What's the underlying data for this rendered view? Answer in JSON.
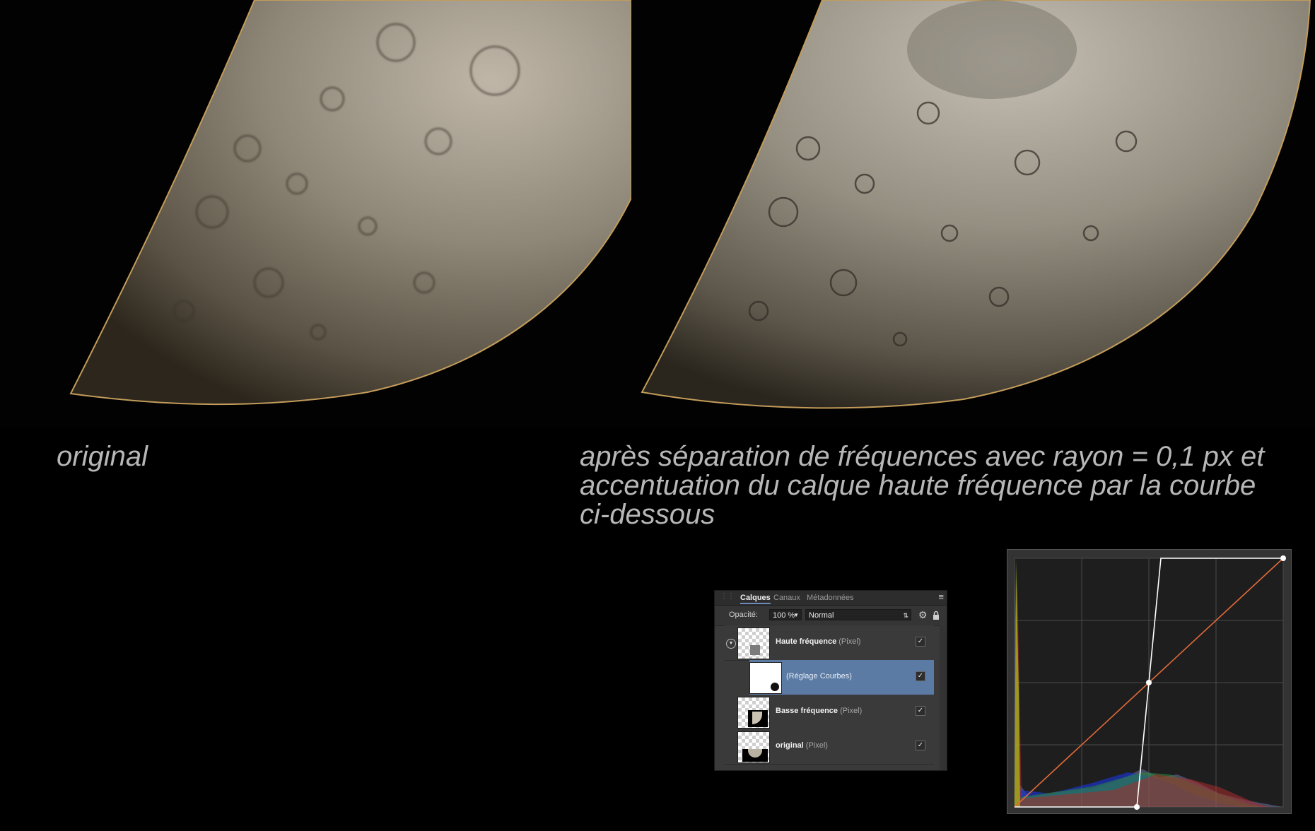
{
  "captions": {
    "left": "original",
    "right_lines": [
      "après séparation de fréquences avec rayon = 0,1 px et",
      "accentuation du calque haute fréquence par la courbe",
      "ci-dessous"
    ]
  },
  "layers_panel": {
    "tabs": [
      "Calques",
      "Canaux",
      "Métadonnées"
    ],
    "active_tab": "Calques",
    "opacity_label": "Opacité:",
    "opacity_value": "100 %",
    "blend_mode": "Normal",
    "layers": [
      {
        "name": "Haute fréquence",
        "type": "(Pixel)",
        "visible": true,
        "expanded": true
      },
      {
        "name": "(Réglage Courbes)",
        "type": "",
        "visible": true,
        "selected": true,
        "child": true
      },
      {
        "name": "Basse fréquence",
        "type": "(Pixel)",
        "visible": true
      },
      {
        "name": "original",
        "type": "(Pixel)",
        "visible": true
      }
    ],
    "icons": [
      "grip-icon",
      "panel-menu-icon",
      "gear-icon",
      "lock-icon",
      "expand-icon",
      "checkbox-icon"
    ]
  },
  "curves": {
    "grid_divisions": 4,
    "curve_color": "#e06a3a",
    "line_color": "#ffffff",
    "curve_points_fraction": [
      [
        0.0,
        0.0
      ],
      [
        0.455,
        0.0
      ],
      [
        0.5,
        0.5
      ],
      [
        0.545,
        1.0
      ],
      [
        1.0,
        1.0
      ]
    ],
    "histogram_colors": [
      "#1a3cff",
      "#2fa84a",
      "#d83030",
      "#c8c020"
    ]
  },
  "colors": {
    "background": "#000000",
    "caption": "#b7b7b7",
    "selected_layer": "#5b7ba5"
  }
}
